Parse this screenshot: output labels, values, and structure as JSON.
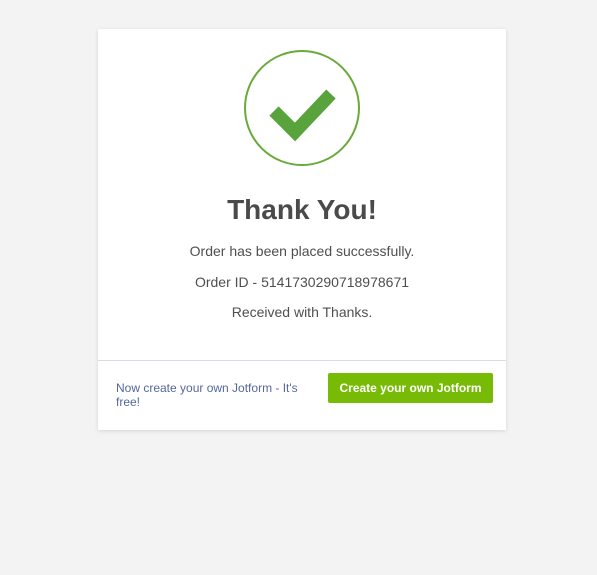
{
  "success_icon": {
    "name": "checkmark-circle-icon",
    "ring_color": "#6aaa3a",
    "check_color": "#58a33c"
  },
  "confirmation": {
    "title": "Thank You!",
    "message": "Order has been placed successfully.",
    "order_id_line": "Order ID - 5141730290718978671",
    "received_line": "Received with Thanks."
  },
  "footer": {
    "promo_text": "Now create your own Jotform - It's free!",
    "cta_label": "Create your own Jotform",
    "cta_color": "#78bb07"
  }
}
